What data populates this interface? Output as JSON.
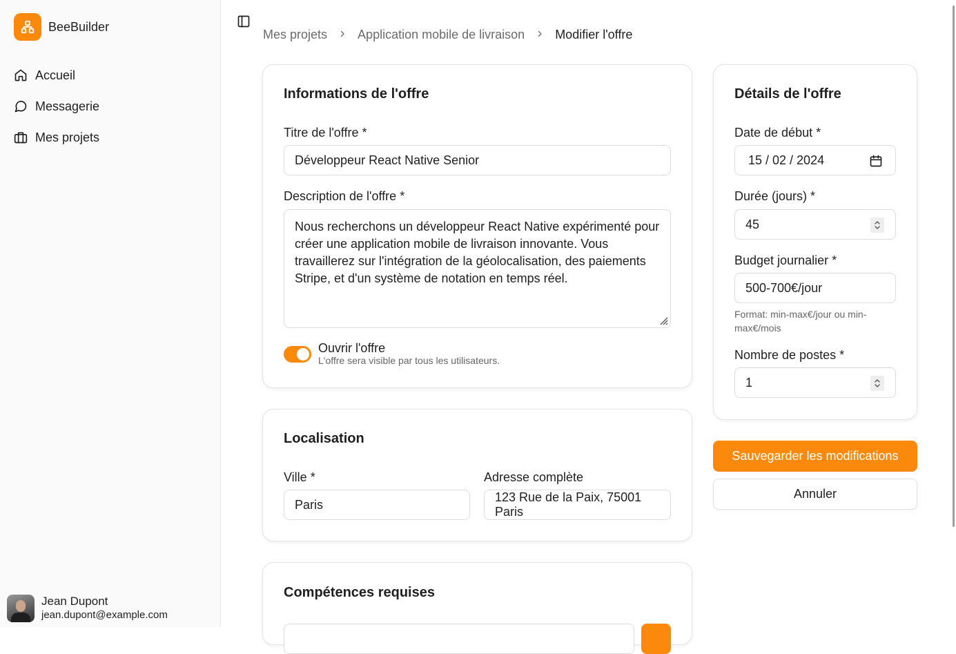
{
  "app": {
    "name": "BeeBuilder",
    "brand_color": "#fb8a0c"
  },
  "sidebar": {
    "items": [
      {
        "label": "Accueil",
        "icon": "home-icon"
      },
      {
        "label": "Messagerie",
        "icon": "message-icon"
      },
      {
        "label": "Mes projets",
        "icon": "briefcase-icon"
      }
    ],
    "user": {
      "name": "Jean Dupont",
      "email": "jean.dupont@example.com"
    }
  },
  "breadcrumb": {
    "items": [
      "Mes projets",
      "Application mobile de livraison"
    ],
    "current": "Modifier l'offre"
  },
  "offer_info": {
    "title": "Informations de l'offre",
    "title_label": "Titre de l'offre *",
    "title_value": "Développeur React Native Senior",
    "description_label": "Description de l'offre *",
    "description_value": "Nous recherchons un développeur React Native expérimenté pour créer une application mobile de livraison innovante. Vous travaillerez sur l'intégration de la géolocalisation, des paiements Stripe, et d'un système de notation en temps réel.",
    "open_label": "Ouvrir l'offre",
    "open_sub": "L'offre sera visible par tous les utilisateurs.",
    "open_enabled": true
  },
  "location": {
    "title": "Localisation",
    "city_label": "Ville *",
    "city_value": "Paris",
    "address_label": "Adresse complète",
    "address_value": "123 Rue de la Paix, 75001 Paris"
  },
  "skills": {
    "title": "Compétences requises"
  },
  "details": {
    "title": "Détails de l'offre",
    "start_label": "Date de début *",
    "start_value": "15 / 02 / 2024",
    "duration_label": "Durée (jours) *",
    "duration_value": "45",
    "budget_label": "Budget journalier *",
    "budget_value": "500-700€/jour",
    "budget_hint": "Format: min-max€/jour ou min-max€/mois",
    "positions_label": "Nombre de postes *",
    "positions_value": "1"
  },
  "actions": {
    "save": "Sauvegarder les modifications",
    "cancel": "Annuler"
  }
}
